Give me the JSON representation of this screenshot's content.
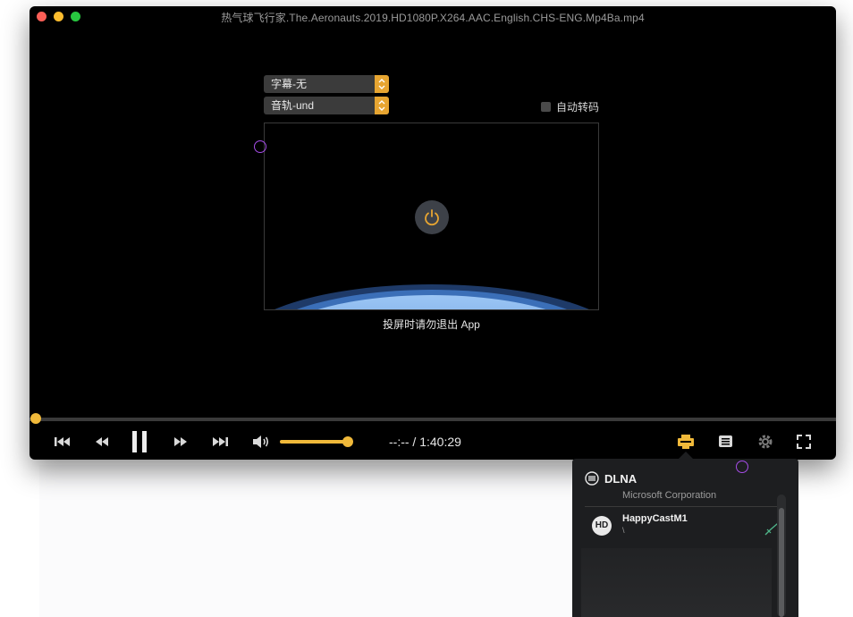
{
  "window": {
    "title": "热气球飞行家.The.Aeronauts.2019.HD1080P.X264.AAC.English.CHS-ENG.Mp4Ba.mp4"
  },
  "player": {
    "subtitle_select": "字幕-无",
    "audio_select": "音轨-und",
    "auto_transcode_label": "自动转码",
    "auto_transcode_checked": false,
    "cast_hint": "投屏时请勿退出 App"
  },
  "controls": {
    "time_display": "--:-- / 1:40:29",
    "progress": 0.0,
    "volume": 0.95,
    "accent_color": "#f0b93a",
    "icons": [
      "skip-back-icon",
      "rewind-icon",
      "pause-icon",
      "fast-forward-icon",
      "skip-forward-icon",
      "volume-icon",
      "cast-icon",
      "playlist-icon",
      "settings-icon",
      "fullscreen-icon"
    ]
  },
  "dlna_popover": {
    "title": "DLNA",
    "subtitle": "Microsoft Corporation",
    "devices": [
      {
        "icon_text": "HD",
        "name": "HappyCastM1",
        "detail": "\\",
        "selected": true
      }
    ]
  }
}
